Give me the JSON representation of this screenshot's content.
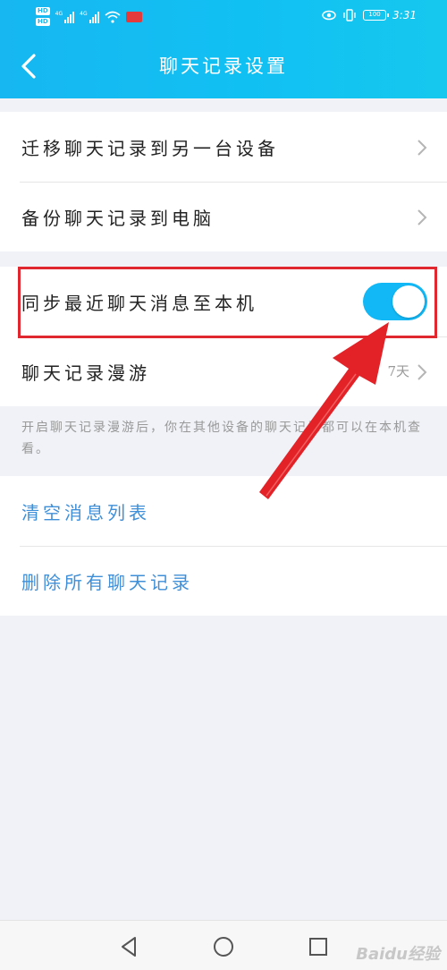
{
  "status_bar": {
    "hd_labels": [
      "HD",
      "HD"
    ],
    "net_labels": [
      "4G",
      "4G"
    ],
    "battery": "100",
    "time": "3:31"
  },
  "header": {
    "title": "聊天记录设置"
  },
  "group1": [
    {
      "label": "迁移聊天记录到另一台设备"
    },
    {
      "label": "备份聊天记录到电脑"
    }
  ],
  "group2": [
    {
      "label": "同步最近聊天消息至本机",
      "toggle_on": true
    },
    {
      "label": "聊天记录漫游",
      "value": "7天"
    }
  ],
  "description": "开启聊天记录漫游后，你在其他设备的聊天记录都可以在本机查看。",
  "group3": [
    {
      "label": "清空消息列表"
    },
    {
      "label": "删除所有聊天记录"
    }
  ],
  "watermark": "Baidu经验",
  "colors": {
    "header": "#15bcf2",
    "toggle": "#12b7f5",
    "link": "#3f8fd8",
    "highlight": "#e0262e"
  }
}
